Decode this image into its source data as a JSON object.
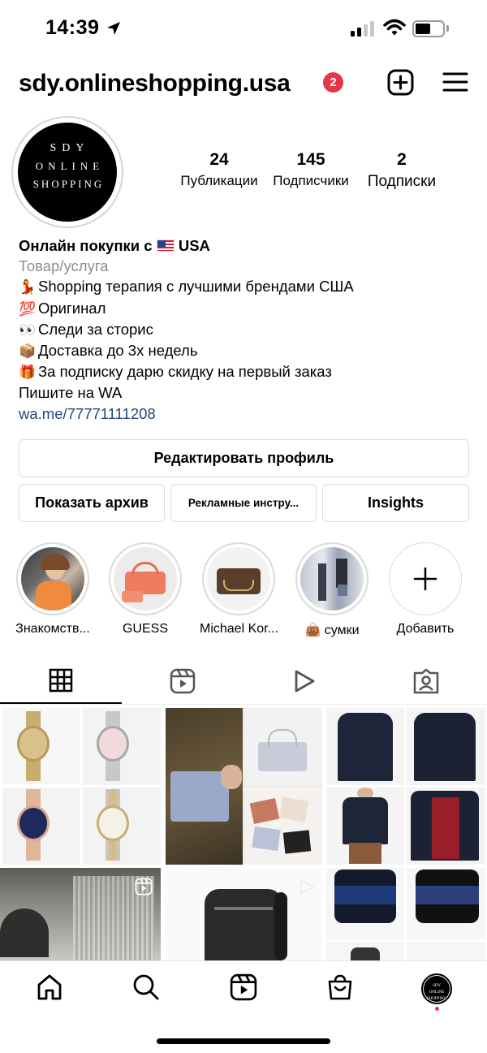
{
  "status_bar": {
    "time": "14:39"
  },
  "header": {
    "username": "sdy.onlineshopping.usa",
    "notification_count": "2"
  },
  "profile": {
    "avatar_lines": [
      "SDY",
      "ONLINE",
      "SHOPPING"
    ],
    "stats": {
      "posts": {
        "value": "24",
        "label": "Публикации"
      },
      "followers": {
        "value": "145",
        "label": "Подписчики"
      },
      "following": {
        "value": "2",
        "label": "Подписки"
      }
    },
    "bio": {
      "name_prefix": "Онлайн покупки с ",
      "name_suffix": " USA",
      "category": "Товар/услуга",
      "lines": [
        {
          "emoji": "💃",
          "text": "Shopping терапия с лучшими брендами США"
        },
        {
          "emoji": "💯",
          "text": "Оригинал"
        },
        {
          "emoji": "👀",
          "text": "Следи за сторис"
        },
        {
          "emoji": "📦",
          "text": "Доставка до 3х недель"
        },
        {
          "emoji": "🎁",
          "text": "За подписку дарю скидку на первый заказ"
        }
      ],
      "contact": "Пишите на WA",
      "link": "wa.me/77771111208"
    }
  },
  "buttons": {
    "edit_profile": "Редактировать профиль",
    "show_archive": "Показать архив",
    "ad_tools": "Рекламные инстру...",
    "insights": "Insights"
  },
  "highlights": [
    {
      "label": "Знакомств..."
    },
    {
      "label": "GUESS"
    },
    {
      "label": "Michael Kor..."
    },
    {
      "emoji": "👜",
      "label": " сумки"
    },
    {
      "label": "Добавить"
    }
  ],
  "tabs": [
    "grid-icon",
    "reels-icon",
    "video-icon",
    "tagged-icon"
  ],
  "nav": [
    "home-icon",
    "search-icon",
    "reels-icon",
    "shop-icon",
    "profile-avatar"
  ],
  "colors": {
    "badge": "#e43646",
    "link": "#24477a",
    "border": "#dbdbdb"
  }
}
